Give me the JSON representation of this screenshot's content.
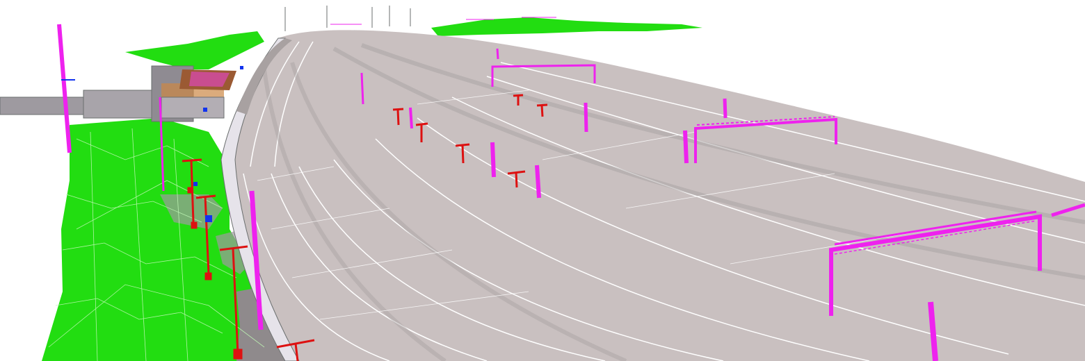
{
  "scene": {
    "kind": "3D BIM model view of a curved multi-track railway viaduct",
    "elements": {
      "terrain": "green-terrain-mesh",
      "viaduct": "grey-concrete-viaduct-deck",
      "tracks": "rail-track-beds",
      "gantries": "magenta-catenary-gantries",
      "masts": "magenta-catenary-masts",
      "signals": "red-signal-posts",
      "buildings": "station-buildings",
      "platforms": "brown-platform-canopies"
    }
  },
  "colors": {
    "background": "#ffffff",
    "terrain": "#22dd11",
    "terrain_line": "#bff7b5",
    "deck": "#c9c0c0",
    "deck_light": "#e6e3ea",
    "deck_dark": "#a8a1a1",
    "track_line": "#ffffff",
    "catenary": "#ee22ee",
    "signal": "#dd1111",
    "building": "#9e9aa0",
    "roof": "#9b5a33",
    "cabin": "#1b8a7a",
    "marker_blue": "#1133ee",
    "outline": "#6b6f6f"
  }
}
